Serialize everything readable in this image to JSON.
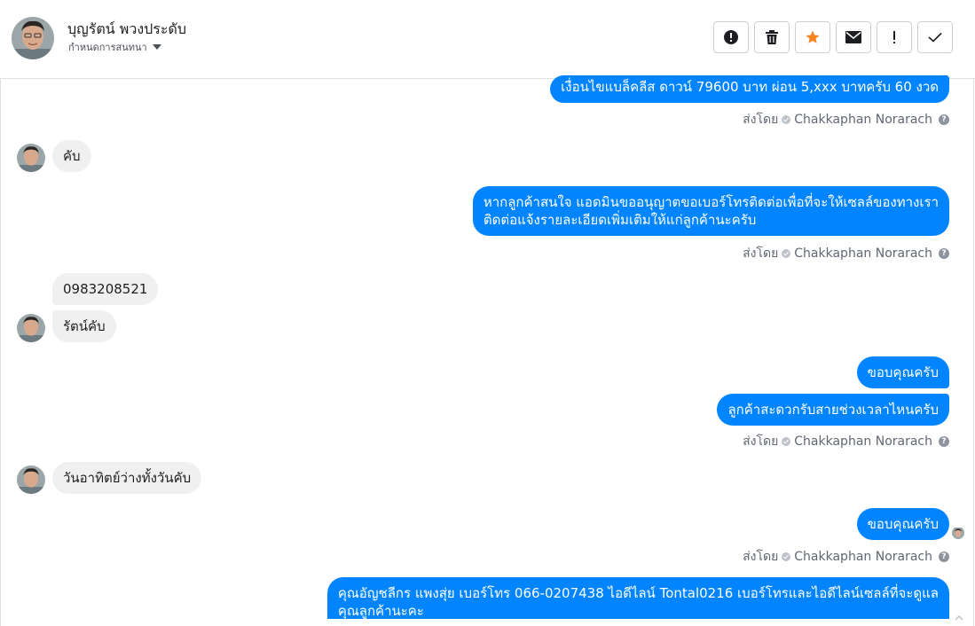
{
  "header": {
    "name": "บุญรัตน์ พวงประดับ",
    "subtitle": "กำหนดการสนทนา",
    "toolbar": [
      {
        "name": "spam-button",
        "icon": "alert-circle-icon"
      },
      {
        "name": "delete-button",
        "icon": "trash-icon"
      },
      {
        "name": "star-button",
        "icon": "star-icon",
        "color": "#f5821f"
      },
      {
        "name": "mark-unread-button",
        "icon": "envelope-icon"
      },
      {
        "name": "mark-important-button",
        "icon": "exclamation-icon"
      },
      {
        "name": "mark-done-button",
        "icon": "checkmark-icon"
      }
    ]
  },
  "colors": {
    "outgoing_bubble": "#0084ff",
    "incoming_bubble": "#f0f0f0",
    "accent_star": "#f5821f"
  },
  "messages": {
    "m1": "เงื่อนไขแบล็คลีส ดาวน์ 79600 บาท ผ่อน 5,xxx บาทครับ 60 งวด",
    "s1": "ส่งโดย",
    "s1_name": "Chakkaphan Norarach",
    "m2": "คับ",
    "m3_line1": "หากลูกค้าสนใจ แอดมินขออนุญาตขอเบอร์โทรติดต่อเพื่อที่จะให้เซลล์ของทางเรา",
    "m3_line2": "ติดต่อแจ้งรายละเอียดเพิ่มเติมให้แก่ลูกค้านะครับ",
    "s2": "ส่งโดย",
    "s2_name": "Chakkaphan Norarach",
    "m4": "0983208521",
    "m5": "รัตน์คับ",
    "m6": "ขอบคุณครับ",
    "m7": "ลูกค้าสะดวกรับสายช่วงเวลาไหนครับ",
    "s3": "ส่งโดย",
    "s3_name": "Chakkaphan Norarach",
    "m8": "วันอาทิตย์ว่างทั้งวันคับ",
    "m9": "ขอบคุณครับ",
    "s4": "ส่งโดย",
    "s4_name": "Chakkaphan Norarach",
    "m10_line1": "คุณอัญชลีกร แพงสุ่ย      เบอร์โทร 066-0207438 ไอดีไลน์ Tontal0216   เบอร์โทรและไอดีไลน์เซลล์ที่จะดูแล",
    "m10_line2": "คุณลูกค้านะคะ"
  }
}
